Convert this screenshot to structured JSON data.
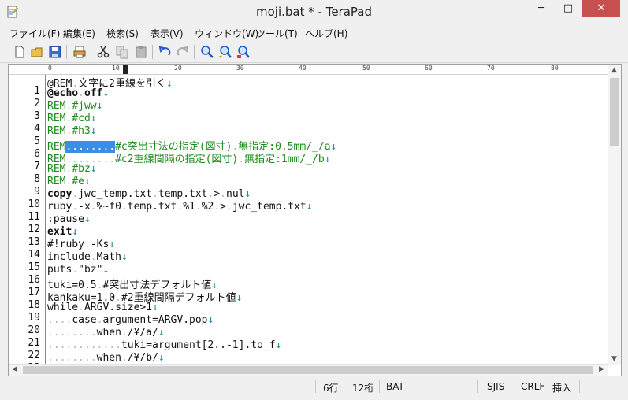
{
  "window": {
    "title": "moji.bat * - TeraPad",
    "min": "─",
    "max": "□",
    "close": "✕"
  },
  "menu": [
    "ファイル(F)",
    "編集(E)",
    "検索(S)",
    "表示(V)",
    "ウィンドウ(W)",
    "ツール(T)",
    "ヘルプ(H)"
  ],
  "ruler": [
    "0",
    "10",
    "20",
    "30",
    "40",
    "50",
    "60",
    "70",
    "80"
  ],
  "editor": {
    "lines": [
      [
        [
          "t",
          "@REM"
        ],
        [
          "w",
          "."
        ],
        [
          "t",
          "文字に2重線を引く"
        ],
        [
          "n",
          "↓"
        ]
      ],
      [
        [
          "b",
          "@echo"
        ],
        [
          "w",
          "."
        ],
        [
          "b",
          "off"
        ],
        [
          "n",
          "↓"
        ]
      ],
      [
        [
          "r",
          "REM"
        ],
        [
          "w",
          "."
        ],
        [
          "r",
          "#jww"
        ],
        [
          "n",
          "↓"
        ]
      ],
      [
        [
          "r",
          "REM"
        ],
        [
          "w",
          "."
        ],
        [
          "r",
          "#cd"
        ],
        [
          "n",
          "↓"
        ]
      ],
      [
        [
          "r",
          "REM"
        ],
        [
          "w",
          "."
        ],
        [
          "r",
          "#h3"
        ],
        [
          "n",
          "↓"
        ]
      ],
      [
        [
          "r",
          "REM"
        ],
        [
          "s",
          "........"
        ],
        [
          "r",
          "#c突出寸法の指定(図寸)"
        ],
        [
          "w",
          "."
        ],
        [
          "r",
          "無指定:0.5mm/_/a"
        ],
        [
          "n",
          "↓"
        ]
      ],
      [
        [
          "r",
          "REM"
        ],
        [
          "w",
          "........"
        ],
        [
          "r",
          "#c2重線間隔の指定(図寸)"
        ],
        [
          "w",
          "."
        ],
        [
          "r",
          "無指定:1mm/_/b"
        ],
        [
          "n",
          "↓"
        ]
      ],
      [
        [
          "r",
          "REM"
        ],
        [
          "w",
          "."
        ],
        [
          "r",
          "#bz"
        ],
        [
          "n",
          "↓"
        ]
      ],
      [
        [
          "r",
          "REM"
        ],
        [
          "w",
          "."
        ],
        [
          "r",
          "#e"
        ],
        [
          "n",
          "↓"
        ]
      ],
      [
        [
          "b",
          "copy"
        ],
        [
          "w",
          "."
        ],
        [
          "t",
          "jwc_temp.txt"
        ],
        [
          "w",
          "."
        ],
        [
          "t",
          "temp.txt"
        ],
        [
          "w",
          "."
        ],
        [
          "t",
          ">"
        ],
        [
          "w",
          "."
        ],
        [
          "t",
          "nul"
        ],
        [
          "n",
          "↓"
        ]
      ],
      [
        [
          "t",
          "ruby"
        ],
        [
          "w",
          "."
        ],
        [
          "t",
          "-x"
        ],
        [
          "w",
          "."
        ],
        [
          "t",
          "%~f0"
        ],
        [
          "w",
          "."
        ],
        [
          "t",
          "temp.txt"
        ],
        [
          "w",
          "."
        ],
        [
          "t",
          "%1"
        ],
        [
          "w",
          "."
        ],
        [
          "t",
          "%2"
        ],
        [
          "w",
          "."
        ],
        [
          "t",
          ">"
        ],
        [
          "w",
          "."
        ],
        [
          "t",
          "jwc_temp.txt"
        ],
        [
          "n",
          "↓"
        ]
      ],
      [
        [
          "t",
          ":pause"
        ],
        [
          "n",
          "↓"
        ]
      ],
      [
        [
          "b",
          "exit"
        ],
        [
          "n",
          "↓"
        ]
      ],
      [
        [
          "t",
          "#!ruby"
        ],
        [
          "w",
          "."
        ],
        [
          "t",
          "-Ks"
        ],
        [
          "n",
          "↓"
        ]
      ],
      [
        [
          "t",
          "include"
        ],
        [
          "w",
          "."
        ],
        [
          "t",
          "Math"
        ],
        [
          "n",
          "↓"
        ]
      ],
      [
        [
          "t",
          "puts"
        ],
        [
          "w",
          "."
        ],
        [
          "t",
          "\"bz\""
        ],
        [
          "n",
          "↓"
        ]
      ],
      [
        [
          "t",
          "tuki=0.5"
        ],
        [
          "w",
          "."
        ],
        [
          "t",
          "#突出寸法デフォルト値"
        ],
        [
          "n",
          "↓"
        ]
      ],
      [
        [
          "t",
          "kankaku=1.0"
        ],
        [
          "w",
          "."
        ],
        [
          "t",
          "#2重線間隔デフォルト値"
        ],
        [
          "n",
          "↓"
        ]
      ],
      [
        [
          "t",
          "while"
        ],
        [
          "w",
          "."
        ],
        [
          "t",
          "ARGV.size>1"
        ],
        [
          "n",
          "↓"
        ]
      ],
      [
        [
          "w",
          "...."
        ],
        [
          "t",
          "case"
        ],
        [
          "w",
          "."
        ],
        [
          "t",
          "argument=ARGV.pop"
        ],
        [
          "n",
          "↓"
        ]
      ],
      [
        [
          "w",
          "........"
        ],
        [
          "t",
          "when"
        ],
        [
          "w",
          "."
        ],
        [
          "t",
          "/¥/a/"
        ],
        [
          "n",
          "↓"
        ]
      ],
      [
        [
          "w",
          "............"
        ],
        [
          "t",
          "tuki=argument[2..-1].to_f"
        ],
        [
          "n",
          "↓"
        ]
      ],
      [
        [
          "w",
          "........"
        ],
        [
          "t",
          "when"
        ],
        [
          "w",
          "."
        ],
        [
          "t",
          "/¥/b/"
        ],
        [
          "n",
          "↓"
        ]
      ]
    ]
  },
  "status": {
    "line": "6行:",
    "col": "12桁",
    "type": "BAT",
    "encoding": "SJIS",
    "eol": "CRLF",
    "mode": "挿入"
  }
}
